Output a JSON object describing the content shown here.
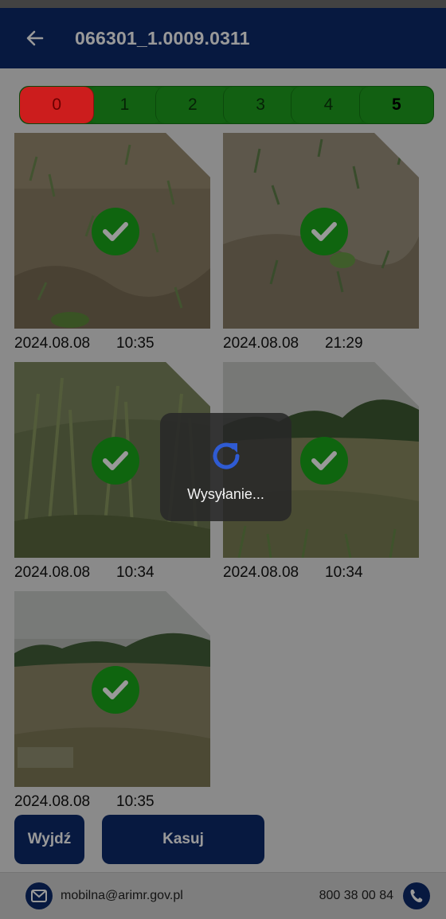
{
  "header": {
    "title": "066301_1.0009.0311",
    "back_icon": "arrow-left-icon"
  },
  "rating": {
    "options": [
      "0",
      "1",
      "2",
      "3",
      "4",
      "5"
    ],
    "selected": "0",
    "colors": {
      "selected": "#cc1d1d",
      "other": "#1fa11f"
    }
  },
  "photos": [
    {
      "date": "2024.08.08",
      "time": "10:35",
      "icon": "eye-icon",
      "status_icon": "check-icon"
    },
    {
      "date": "2024.08.08",
      "time": "21:29",
      "icon": "eye-icon",
      "status_icon": "check-icon"
    },
    {
      "date": "2024.08.08",
      "time": "10:34",
      "icon": "eye-icon",
      "status_icon": "check-icon"
    },
    {
      "date": "2024.08.08",
      "time": "10:34",
      "icon": "eye-icon",
      "status_icon": "check-icon"
    },
    {
      "date": "2024.08.08",
      "time": "10:35",
      "icon": "eye-icon",
      "status_icon": "check-icon"
    }
  ],
  "buttons": {
    "exit": "Wyjdź",
    "delete": "Kasuj"
  },
  "footer": {
    "email": "mobilna@arimr.gov.pl",
    "phone": "800 38 00 84"
  },
  "loading": {
    "text": "Wysyłanie...",
    "icon": "refresh-icon"
  },
  "theme": {
    "primary": "#0d2b6b",
    "success": "#1aa81a"
  }
}
